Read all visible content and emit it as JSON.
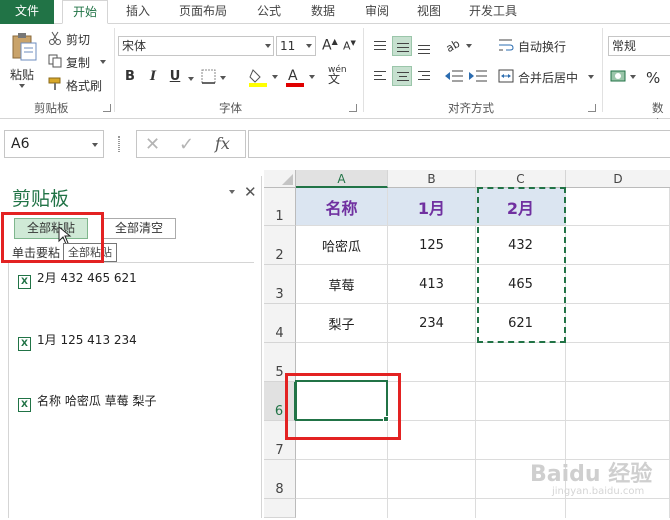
{
  "ribbon_tabs": [
    "文件",
    "开始",
    "插入",
    "页面布局",
    "公式",
    "数据",
    "审阅",
    "视图",
    "开发工具"
  ],
  "clipboard_group": {
    "paste_label": "粘贴",
    "cut_label": "剪切",
    "copy_label": "复制",
    "format_painter_label": "格式刷",
    "group_label": "剪贴板"
  },
  "font_group": {
    "font_name": "宋体",
    "font_size": "11",
    "bold": "B",
    "italic": "I",
    "underline": "U",
    "phonetic": "wén",
    "group_label": "字体"
  },
  "align_group": {
    "wrap_text_label": "自动换行",
    "merge_center_label": "合并后居中",
    "group_label": "对齐方式"
  },
  "number_group": {
    "format_value": "常规",
    "percent": "%",
    "group_label": "数字"
  },
  "formula_bar": {
    "name_box": "A6",
    "fx": "fx",
    "formula": ""
  },
  "clipboard_pane": {
    "title": "剪贴板",
    "paste_all_label": "全部粘贴",
    "clear_all_label": "全部清空",
    "hint_text": "单击要粘",
    "tooltip": "全部粘贴",
    "items": [
      "2月 432 465 621",
      "1月 125 413 234",
      "名称 哈密瓜 草莓 梨子"
    ]
  },
  "sheet": {
    "columns": [
      "A",
      "B",
      "C",
      "D"
    ],
    "rows": [
      "1",
      "2",
      "3",
      "4",
      "5",
      "6",
      "7",
      "8"
    ],
    "header_row": [
      "名称",
      "1月",
      "2月"
    ],
    "data_rows": [
      [
        "哈密瓜",
        "125",
        "432"
      ],
      [
        "草莓",
        "413",
        "465"
      ],
      [
        "梨子",
        "234",
        "621"
      ]
    ],
    "selected_cell": "A6"
  },
  "watermark": {
    "main": "Baidu 经验",
    "sub": "jingyan.baidu.com"
  },
  "colors": {
    "excel_green": "#217346",
    "header_fill": "#dbe5f1",
    "header_text": "#7030a0",
    "highlight_red": "#e32222"
  }
}
